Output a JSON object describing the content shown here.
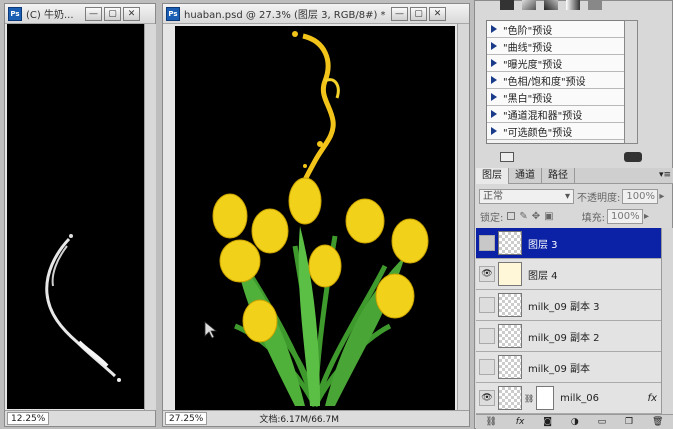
{
  "left_window": {
    "title": "(C) 牛奶...",
    "zoom": "12.25%"
  },
  "main_window": {
    "title": "huaban.psd @ 27.3% (图层 3, RGB/8#) *",
    "zoom": "27.25%",
    "doc_info": "文档:6.17M/66.7M"
  },
  "window_buttons": {
    "minimize": "—",
    "restore": "▢",
    "close": "✕"
  },
  "adjust_presets": [
    "\"色阶\"预设",
    "\"曲线\"预设",
    "\"曝光度\"预设",
    "\"色相/饱和度\"预设",
    "\"黑白\"预设",
    "\"通道混和器\"预设",
    "\"可选颜色\"预设"
  ],
  "tabs": [
    "图层",
    "通道",
    "路径"
  ],
  "blend_mode": "正常",
  "opacity_label": "不透明度:",
  "opacity_value": "100%",
  "lock_label": "锁定:",
  "fill_label": "填充:",
  "fill_value": "100%",
  "layers": [
    {
      "name": "图层 3",
      "selected": true,
      "visible": false
    },
    {
      "name": "图层 4",
      "selected": false,
      "visible": true
    },
    {
      "name": "milk_09 副本 3",
      "selected": false,
      "visible": false
    },
    {
      "name": "milk_09 副本 2",
      "selected": false,
      "visible": false
    },
    {
      "name": "milk_09 副本",
      "selected": false,
      "visible": false
    },
    {
      "name": "milk_06",
      "selected": false,
      "visible": true
    }
  ],
  "bottom_icons": [
    "link-icon",
    "fx-icon",
    "mask-icon",
    "adjustment-icon",
    "group-icon",
    "new-layer-icon",
    "trash-icon"
  ],
  "bottom_labels": {
    "fx": "fx"
  },
  "colors": {
    "selected_layer": "#0b22a6",
    "tulip": "#f2d11a",
    "stem": "#3f9a2d"
  }
}
